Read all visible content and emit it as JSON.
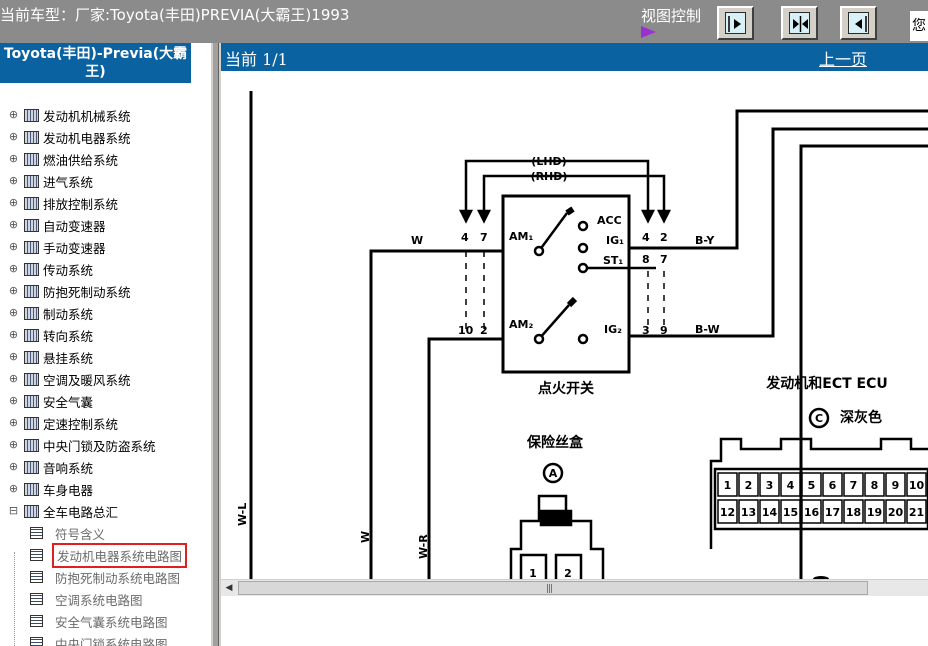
{
  "topbar": {
    "title": "当前车型：厂家:Toyota(丰田)PREVIA(大霸王)1993",
    "view_control_label": "视图控制",
    "user_text": "您"
  },
  "sidebar": {
    "title": "Toyota(丰田)-Previa(大霸王)",
    "items": [
      {
        "label": "发动机机械系统"
      },
      {
        "label": "发动机电器系统"
      },
      {
        "label": "燃油供给系统"
      },
      {
        "label": "进气系统"
      },
      {
        "label": "排放控制系统"
      },
      {
        "label": "自动变速器"
      },
      {
        "label": "手动变速器"
      },
      {
        "label": "传动系统"
      },
      {
        "label": "防抱死制动系统"
      },
      {
        "label": "制动系统"
      },
      {
        "label": "转向系统"
      },
      {
        "label": "悬挂系统"
      },
      {
        "label": "空调及暖风系统"
      },
      {
        "label": "安全气囊"
      },
      {
        "label": "定速控制系统"
      },
      {
        "label": "中央门锁及防盗系统"
      },
      {
        "label": "音响系统"
      },
      {
        "label": "车身电器"
      },
      {
        "label": "全车电路总汇"
      }
    ],
    "children": [
      {
        "label": "符号含义"
      },
      {
        "label": "发动机电器系统电路图"
      },
      {
        "label": "防抱死制动系统电路图"
      },
      {
        "label": "空调系统电路图"
      },
      {
        "label": "安全气囊系统电路图"
      },
      {
        "label": "中央门锁系统电路图"
      }
    ]
  },
  "main": {
    "page_indicator": "当前 1/1",
    "prev_page": "上一页"
  },
  "diagram": {
    "lhd": "(LHD)",
    "rhd": "(RHD)",
    "acc": "ACC",
    "ig1": "IG₁",
    "st1": "ST₁",
    "ig2": "IG₂",
    "am1": "AM₁",
    "am2": "AM₂",
    "pin4a": "4",
    "pin7a": "7",
    "pin4b": "4",
    "pin2b": "2",
    "pin8": "8",
    "pin7b": "7",
    "pin10": "10",
    "pin2c": "2",
    "pin3": "3",
    "pin9": "9",
    "wire_w": "W",
    "wire_by": "B-Y",
    "wire_bw": "B-W",
    "wire_wl": "W-L",
    "wire_w2": "W",
    "wire_wr": "W-R",
    "ignition_switch": "点火开关",
    "ecu_label": "发动机和ECT ECU",
    "ecu_conn": "C",
    "ecu_color": "深灰色",
    "fuse_box": "保险丝盒",
    "fuse_conn": "A",
    "fuse_pin1": "1",
    "fuse_pin2": "2",
    "ecu_row1": [
      "1",
      "2",
      "3",
      "4",
      "5",
      "6",
      "7",
      "8",
      "9",
      "10"
    ],
    "ecu_row2": [
      "12",
      "13",
      "14",
      "15",
      "16",
      "17",
      "18",
      "19",
      "20",
      "21"
    ]
  }
}
